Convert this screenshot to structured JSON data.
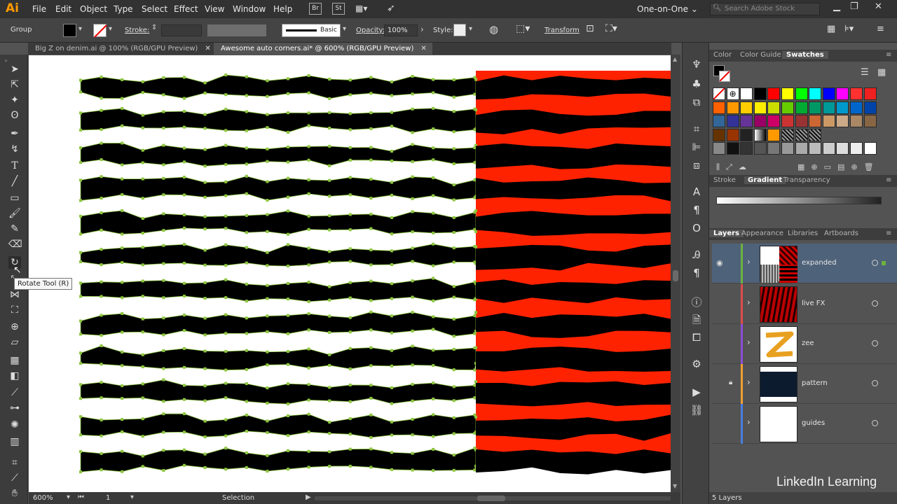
{
  "menubar": {
    "logo": "Ai",
    "items": [
      "File",
      "Edit",
      "Object",
      "Type",
      "Select",
      "Effect",
      "View",
      "Window",
      "Help"
    ],
    "bridge": "Br",
    "stock": "St",
    "workspace": "One-on-One",
    "search_placeholder": "Search Adobe Stock"
  },
  "control": {
    "selection": "Group",
    "stroke_label": "Stroke:",
    "brush": "Basic",
    "opacity_label": "Opacity:",
    "opacity_value": "100%",
    "style_label": "Style:",
    "transform_label": "Transform"
  },
  "tabs": [
    {
      "label": "Big Z on denim.ai @ 100% (RGB/GPU Preview)"
    },
    {
      "label": "Awesome auto corners.ai* @ 600% (RGB/GPU Preview)"
    }
  ],
  "tooltip": "Rotate Tool (R)",
  "status": {
    "zoom": "600%",
    "artboard": "1",
    "mode": "Selection"
  },
  "panels": {
    "swatch_tabs": [
      "Color",
      "Color Guide",
      "Swatches"
    ],
    "gradient_tabs": [
      "Stroke",
      "Gradient",
      "Transparency"
    ],
    "layer_tabs": [
      "Layers",
      "Appearance",
      "Libraries",
      "Artboards"
    ],
    "layers": [
      {
        "name": "expanded",
        "color": "#6db33f"
      },
      {
        "name": "live FX",
        "color": "#e04c4c"
      },
      {
        "name": "zee",
        "color": "#8a4fd6"
      },
      {
        "name": "pattern",
        "color": "#f0a030"
      },
      {
        "name": "guides",
        "color": "#4a7de0"
      }
    ],
    "layer_count": "5 Layers"
  },
  "watermark": "LinkedIn Learning",
  "colors": {
    "accent_red": "#ff2200",
    "path_green": "#8dc63f"
  }
}
